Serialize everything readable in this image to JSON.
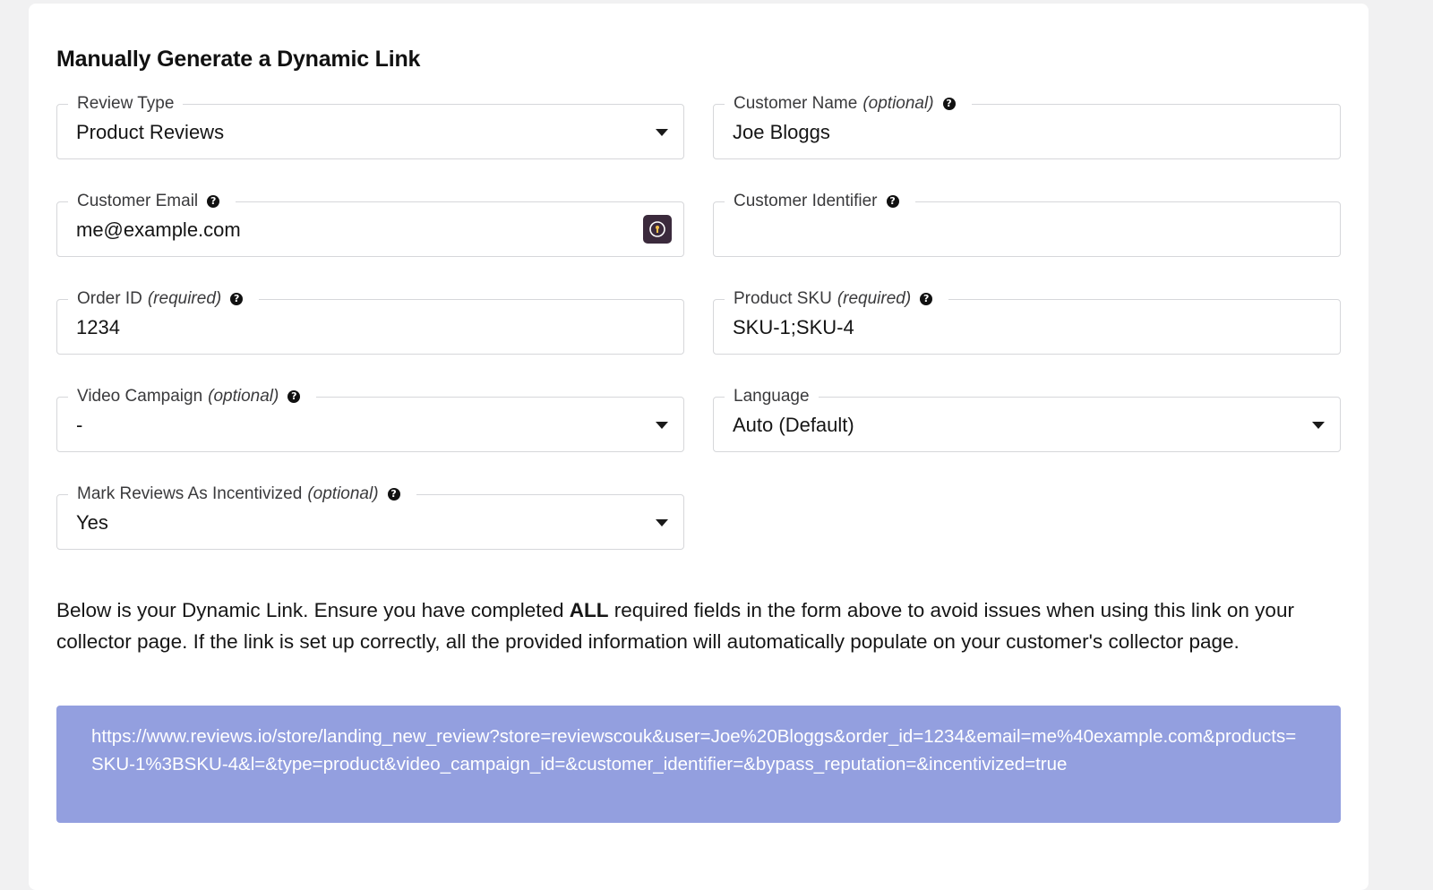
{
  "title": "Manually Generate a Dynamic Link",
  "fields": {
    "review_type": {
      "label": "Review Type",
      "value": "Product Reviews"
    },
    "customer_name": {
      "label": "Customer Name",
      "qualifier": "(optional)",
      "value": "Joe Bloggs"
    },
    "customer_email": {
      "label": "Customer Email",
      "value": "me@example.com"
    },
    "customer_identifier": {
      "label": "Customer Identifier",
      "value": ""
    },
    "order_id": {
      "label": "Order ID",
      "qualifier": "(required)",
      "value": "1234"
    },
    "product_sku": {
      "label": "Product SKU",
      "qualifier": "(required)",
      "value": "SKU-1;SKU-4"
    },
    "video_campaign": {
      "label": "Video Campaign",
      "qualifier": "(optional)",
      "value": "-"
    },
    "language": {
      "label": "Language",
      "value": "Auto (Default)"
    },
    "incentivized": {
      "label": "Mark Reviews As Incentivized",
      "qualifier": "(optional)",
      "value": "Yes"
    }
  },
  "help_glyph": "?",
  "description": {
    "before": "Below is your Dynamic Link. Ensure you have completed ",
    "emphasis": "ALL",
    "after": " required fields in the form above to avoid issues when using this link on your collector page. If the link is set up correctly, all the provided information will automatically populate on your customer's collector page."
  },
  "dynamic_link": "https://www.reviews.io/store/landing_new_review?store=reviewscouk&user=Joe%20Bloggs&order_id=1234&email=me%40example.com&products=SKU-1%3BSKU-4&l=&type=product&video_campaign_id=&customer_identifier=&bypass_reputation=&incentivized=true",
  "colors": {
    "link_box_bg": "#939fdf",
    "password_manager_icon_bg": "#3b2a3c",
    "field_border": "#d6d7da"
  },
  "icons": {
    "help": "question-circle-icon",
    "dropdown": "caret-down-icon",
    "password_manager": "password-manager-icon"
  }
}
